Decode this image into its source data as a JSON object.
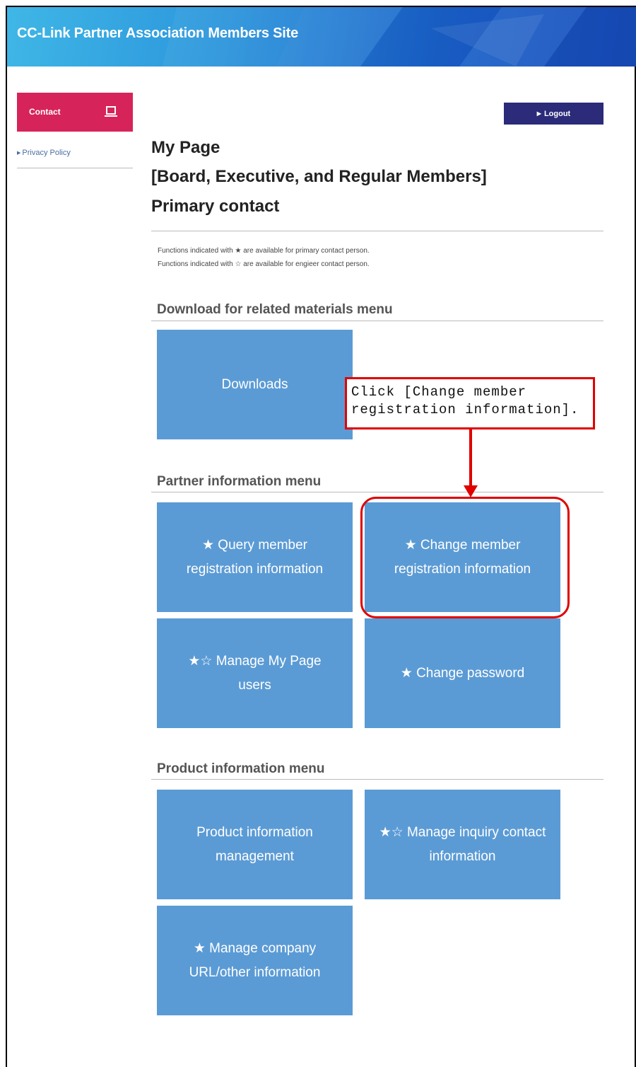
{
  "header": {
    "site_title": "CC-Link Partner Association Members Site"
  },
  "sidebar": {
    "contact_label": "Contact",
    "contact_icon": "laptop-icon",
    "privacy_label": "Privacy Policy"
  },
  "toolbar": {
    "logout_label": "Logout"
  },
  "page": {
    "title_line1": "My Page",
    "title_line2": "[Board, Executive, and Regular Members]",
    "title_line3": "Primary contact",
    "note1": "Functions indicated with ★ are available for primary contact person.",
    "note2": "Functions indicated with ☆ are available for engieer contact person."
  },
  "sections": {
    "download": {
      "title": "Download for related materials menu",
      "tiles": [
        "Downloads"
      ]
    },
    "partner": {
      "title": "Partner information menu",
      "tiles": [
        "★ Query member registration information",
        "★ Change member registration information",
        "★☆ Manage My Page users",
        "★ Change password"
      ]
    },
    "product": {
      "title": "Product information menu",
      "tiles": [
        "Product information management",
        "★☆ Manage inquiry contact information",
        "★ Manage company URL/other information"
      ]
    }
  },
  "annotation": {
    "callout_text": "Click [Change member registration information]."
  },
  "colors": {
    "tile": "#5b9bd5",
    "contact": "#d6245a",
    "logout": "#2b2b7a",
    "annotation": "#e00000"
  }
}
